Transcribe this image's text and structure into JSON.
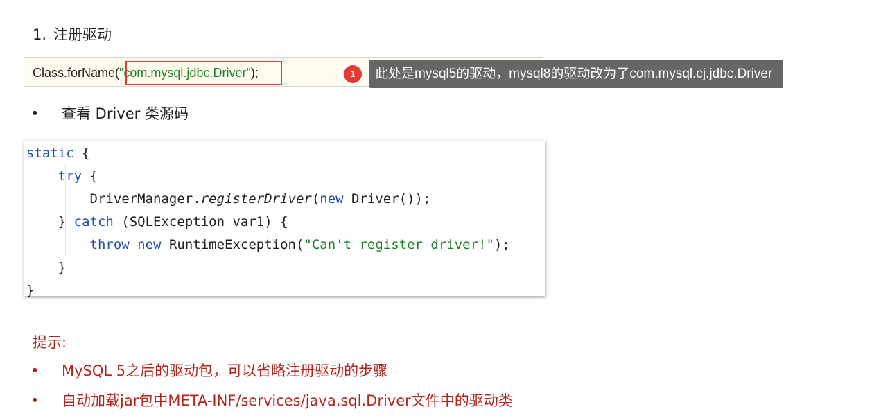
{
  "heading": {
    "number": "1.",
    "text": "注册驱动"
  },
  "code_line": {
    "prefix": "Class.forName(",
    "string": "\"com.mysql.jdbc.Driver\"",
    "suffix": ");"
  },
  "annotation": {
    "marker": "1",
    "note": "此处是mysql5的驱动，mysql8的驱动改为了com.mysql.cj.jdbc.Driver"
  },
  "section": {
    "bullet": "•",
    "label": "查看 Driver 类源码"
  },
  "source_code": {
    "l1_kw": "static",
    "l1_rest": " {",
    "l2_kw": "try",
    "l2_rest": " {",
    "l3_a": "DriverManager.",
    "l3_method": "registerDriver",
    "l3_b": "(",
    "l3_kw": "new",
    "l3_c": " Driver());",
    "l4_a": "} ",
    "l4_kw": "catch",
    "l4_b": " (SQLException var1) {",
    "l5_kw1": "throw",
    "l5_kw2": "new",
    "l5_a": " RuntimeException(",
    "l5_str": "\"Can't register driver!\"",
    "l5_b": ");",
    "l6": "}",
    "l7": "}"
  },
  "tips": {
    "title": "提示:",
    "bullet": "•",
    "items": [
      "MySQL 5之后的驱动包，可以省略注册驱动的步骤",
      "自动加载jar包中META-INF/services/java.sql.Driver文件中的驱动类"
    ]
  },
  "colors": {
    "string_green": "#1a7f27",
    "keyword_blue": "#1f4fb5",
    "tip_red": "#b3261e",
    "highlight_red": "#e53935",
    "tooltip_gray": "#666666"
  }
}
